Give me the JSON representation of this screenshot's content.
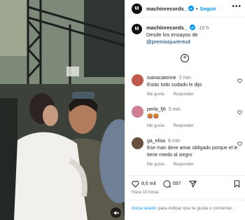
{
  "header": {
    "avatar_text": "M",
    "username": "machinrecords_",
    "separator": "•",
    "follow_label": "Seguir",
    "more_label": "•••"
  },
  "caption": {
    "username": "machinrecords_",
    "time": "10 h",
    "text": "Desde los ensayos de",
    "mention": "@premiosjuventud"
  },
  "load_more_label": "+",
  "comments": [
    {
      "username": "isairacaterine",
      "time": "2 min",
      "text": "Estás todo sudado le dijo",
      "like_label": "Me gusta",
      "reply_label": "Responder",
      "avatar_color": "#c05a4f"
    },
    {
      "username": "perla_fj6",
      "time": "5 min",
      "text": "🥵🥵",
      "like_label": "Me gusta",
      "reply_label": "Responder",
      "avatar_color": "#d17e92"
    },
    {
      "username": "ga_elisa",
      "time": "8 min",
      "text": "Ese man deve amar obligado porque el le tiene miedo al siegro",
      "like_label": "Me gusta",
      "reply_label": "Responder",
      "avatar_color": "#6b4f3e"
    }
  ],
  "actions": {
    "likes_count": "8,6 mil",
    "comments_count": "697"
  },
  "time_ago": "Hace 10 horas",
  "login_prompt": {
    "link_text": "Inicia sesión",
    "rest_text": " para indicar que te gusta o comentar."
  },
  "colors": {
    "accent": "#0095f6",
    "muted": "#737373",
    "text": "#262626"
  }
}
